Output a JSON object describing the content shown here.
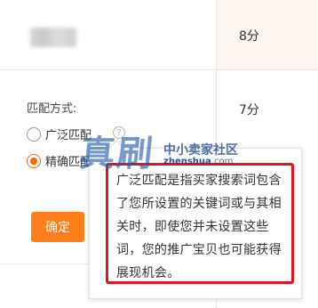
{
  "rows": [
    {
      "score": "8分"
    },
    {
      "score": "7分"
    }
  ],
  "match": {
    "label": "匹配方式:",
    "options": [
      {
        "label": "广泛匹配",
        "checked": false
      },
      {
        "label": "精确匹配",
        "checked": true
      }
    ],
    "help_icon": "question-circle-icon",
    "help_glyph": "?"
  },
  "confirm_label": "确定",
  "tooltip": {
    "text": "广泛匹配是指买家搜索词包含了您所设置的关键词或与其相关时，即使您并未设置这些词，您的推广宝贝也可能获得展现机会。",
    "highlight_color": "#e8141b"
  },
  "watermark": {
    "big": "真刷",
    "small": "中小卖家社区",
    "url_bold": "zhenshua",
    "url_rest": ".com"
  },
  "colors": {
    "accent": "#ff7e1a",
    "radio_checked": "#ff6a00",
    "row_highlight": "#fdf5ef"
  }
}
